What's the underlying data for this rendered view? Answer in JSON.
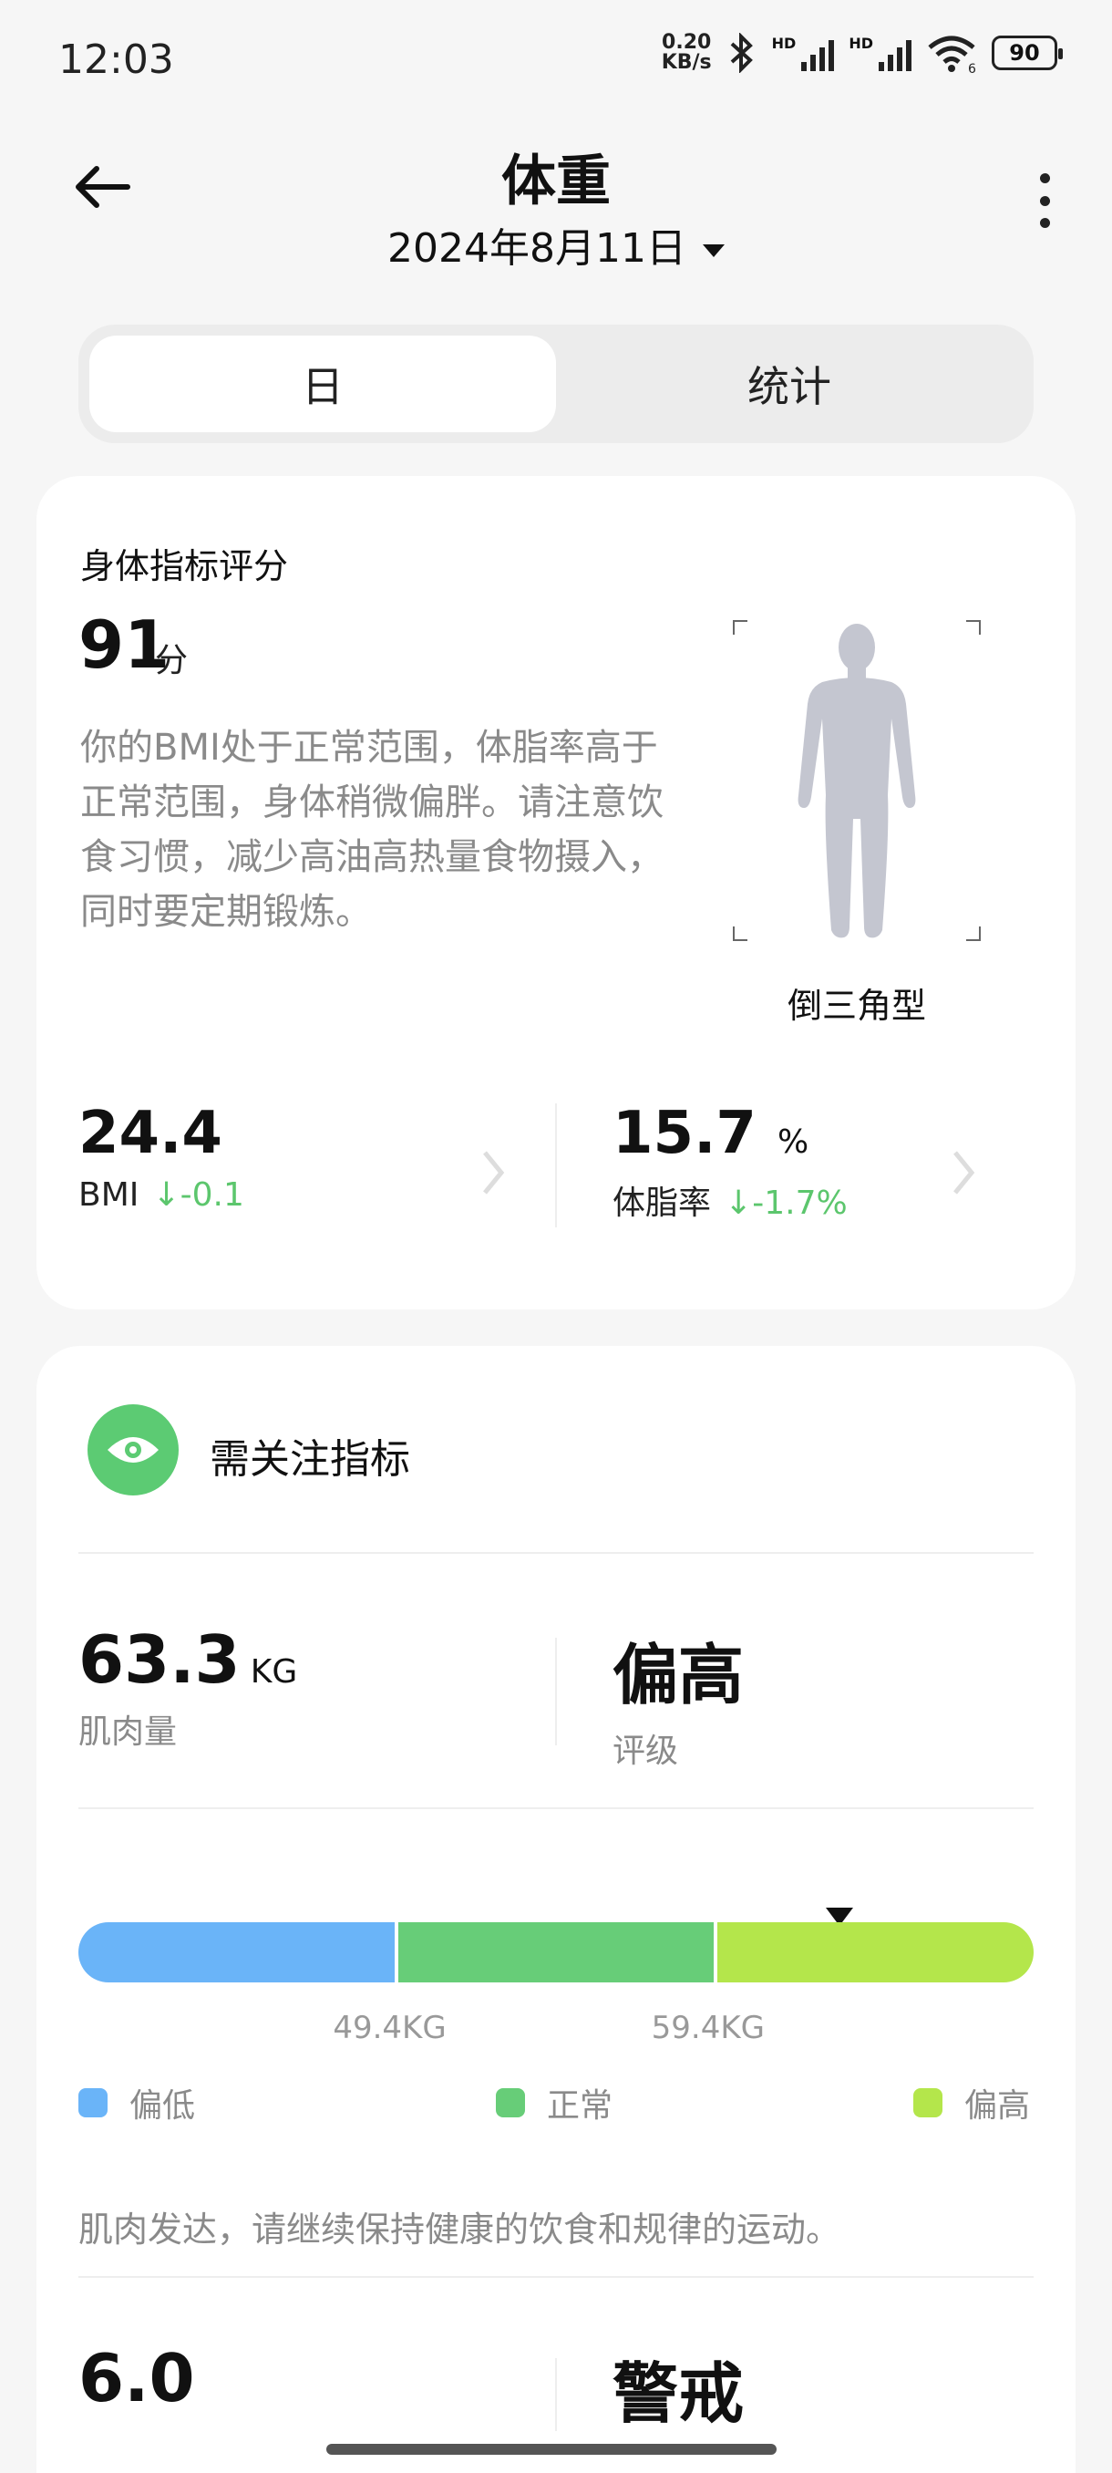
{
  "status_bar": {
    "time": "12:03",
    "net_speed_value": "0.20",
    "net_speed_unit": "KB/s",
    "hd1": "HD",
    "hd2": "HD",
    "wifi_badge": "6",
    "battery": "90"
  },
  "header": {
    "title": "体重",
    "date": "2024年8月11日"
  },
  "tabs": [
    {
      "label": "日",
      "active": true
    },
    {
      "label": "统计",
      "active": false
    }
  ],
  "score_card": {
    "title": "身体指标评分",
    "score": "91",
    "score_unit": "分",
    "description": "你的BMI处于正常范围，体脂率高于正常范围，身体稍微偏胖。请注意饮食习惯，减少高油高热量食物摄入，同时要定期锻炼。",
    "body_type": "倒三角型",
    "metrics": [
      {
        "value": "24.4",
        "unit": "",
        "label": "BMI",
        "delta": "↓-0.1"
      },
      {
        "value": "15.7",
        "unit": "%",
        "label": "体脂率",
        "delta": "↓-1.7%"
      }
    ]
  },
  "attention_card": {
    "title": "需关注指标",
    "muscle": {
      "value": "63.3",
      "unit": "KG",
      "label": "肌肉量",
      "rating": "偏高",
      "rating_label": "评级"
    },
    "range_bar": {
      "min_kg": 39.4,
      "max_kg": 69.4,
      "current_kg": 63.3,
      "thresholds": [
        "49.4KG",
        "59.4KG"
      ],
      "colors": [
        "#6ab4f8",
        "#67cd78",
        "#b4e64b"
      ]
    },
    "legend": [
      {
        "label": "偏低",
        "color": "#6ab4f8"
      },
      {
        "label": "正常",
        "color": "#67cd78"
      },
      {
        "label": "偏高",
        "color": "#b4e64b"
      }
    ],
    "note": "肌肉发达，请继续保持健康的饮食和规律的运动。",
    "next_metric": {
      "value": "6.0",
      "rating": "警戒"
    }
  }
}
